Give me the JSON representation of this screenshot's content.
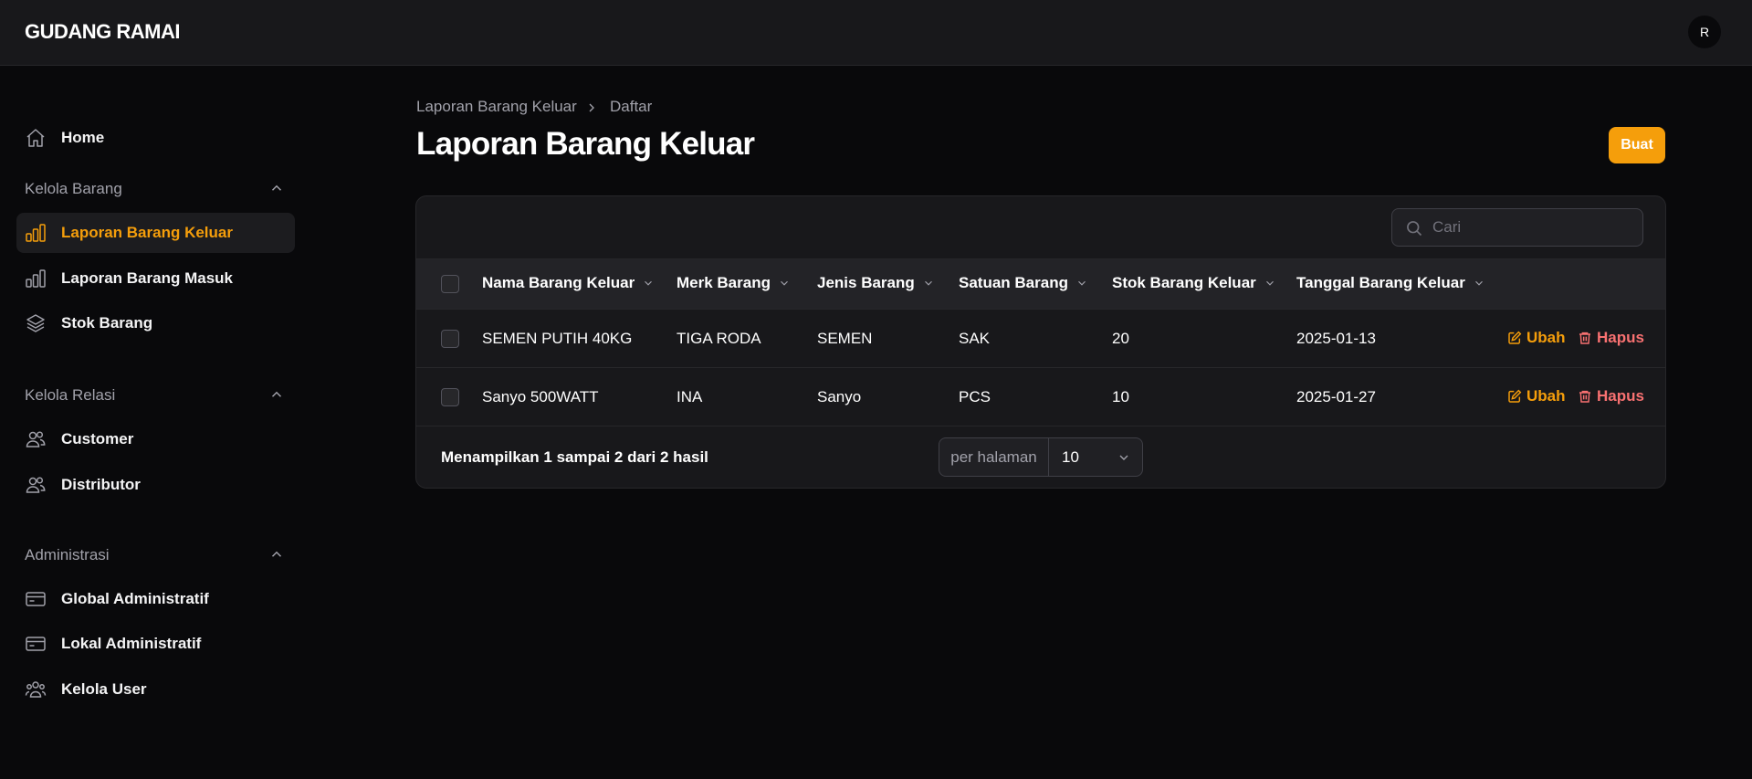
{
  "app": {
    "brand": "GUDANG RAMAI",
    "avatar_initial": "R",
    "accent": "#f59e0b"
  },
  "sidebar": {
    "home": {
      "label": "Home",
      "icon": "home-icon"
    },
    "groups": [
      {
        "title": "Kelola Barang",
        "items": [
          {
            "label": "Laporan Barang Keluar",
            "icon": "bar-chart-icon",
            "active": true
          },
          {
            "label": "Laporan Barang Masuk",
            "icon": "bar-chart-icon",
            "active": false
          },
          {
            "label": "Stok Barang",
            "icon": "layers-icon",
            "active": false
          }
        ]
      },
      {
        "title": "Kelola Relasi",
        "items": [
          {
            "label": "Customer",
            "icon": "users-icon"
          },
          {
            "label": "Distributor",
            "icon": "users-icon"
          }
        ]
      },
      {
        "title": "Administrasi",
        "items": [
          {
            "label": "Global Administratif",
            "icon": "credit-card-icon"
          },
          {
            "label": "Lokal Administratif",
            "icon": "credit-card-icon"
          },
          {
            "label": "Kelola User",
            "icon": "user-group-icon"
          }
        ]
      }
    ]
  },
  "breadcrumb": {
    "parent": "Laporan Barang Keluar",
    "current": "Daftar"
  },
  "page": {
    "title": "Laporan Barang Keluar",
    "create_label": "Buat"
  },
  "search": {
    "placeholder": "Cari"
  },
  "table": {
    "columns": [
      "Nama Barang Keluar",
      "Merk Barang",
      "Jenis Barang",
      "Satuan Barang",
      "Stok Barang Keluar",
      "Tanggal Barang Keluar"
    ],
    "rows": [
      [
        "SEMEN PUTIH 40KG",
        "TIGA RODA",
        "SEMEN",
        "SAK",
        "20",
        "2025-01-13"
      ],
      [
        "Sanyo 500WATT",
        "INA",
        "Sanyo",
        "PCS",
        "10",
        "2025-01-27"
      ]
    ],
    "edit_label": "Ubah",
    "delete_label": "Hapus"
  },
  "footer": {
    "summary": "Menampilkan 1 sampai 2 dari 2 hasil",
    "per_page_label": "per halaman",
    "per_page_value": "10"
  }
}
